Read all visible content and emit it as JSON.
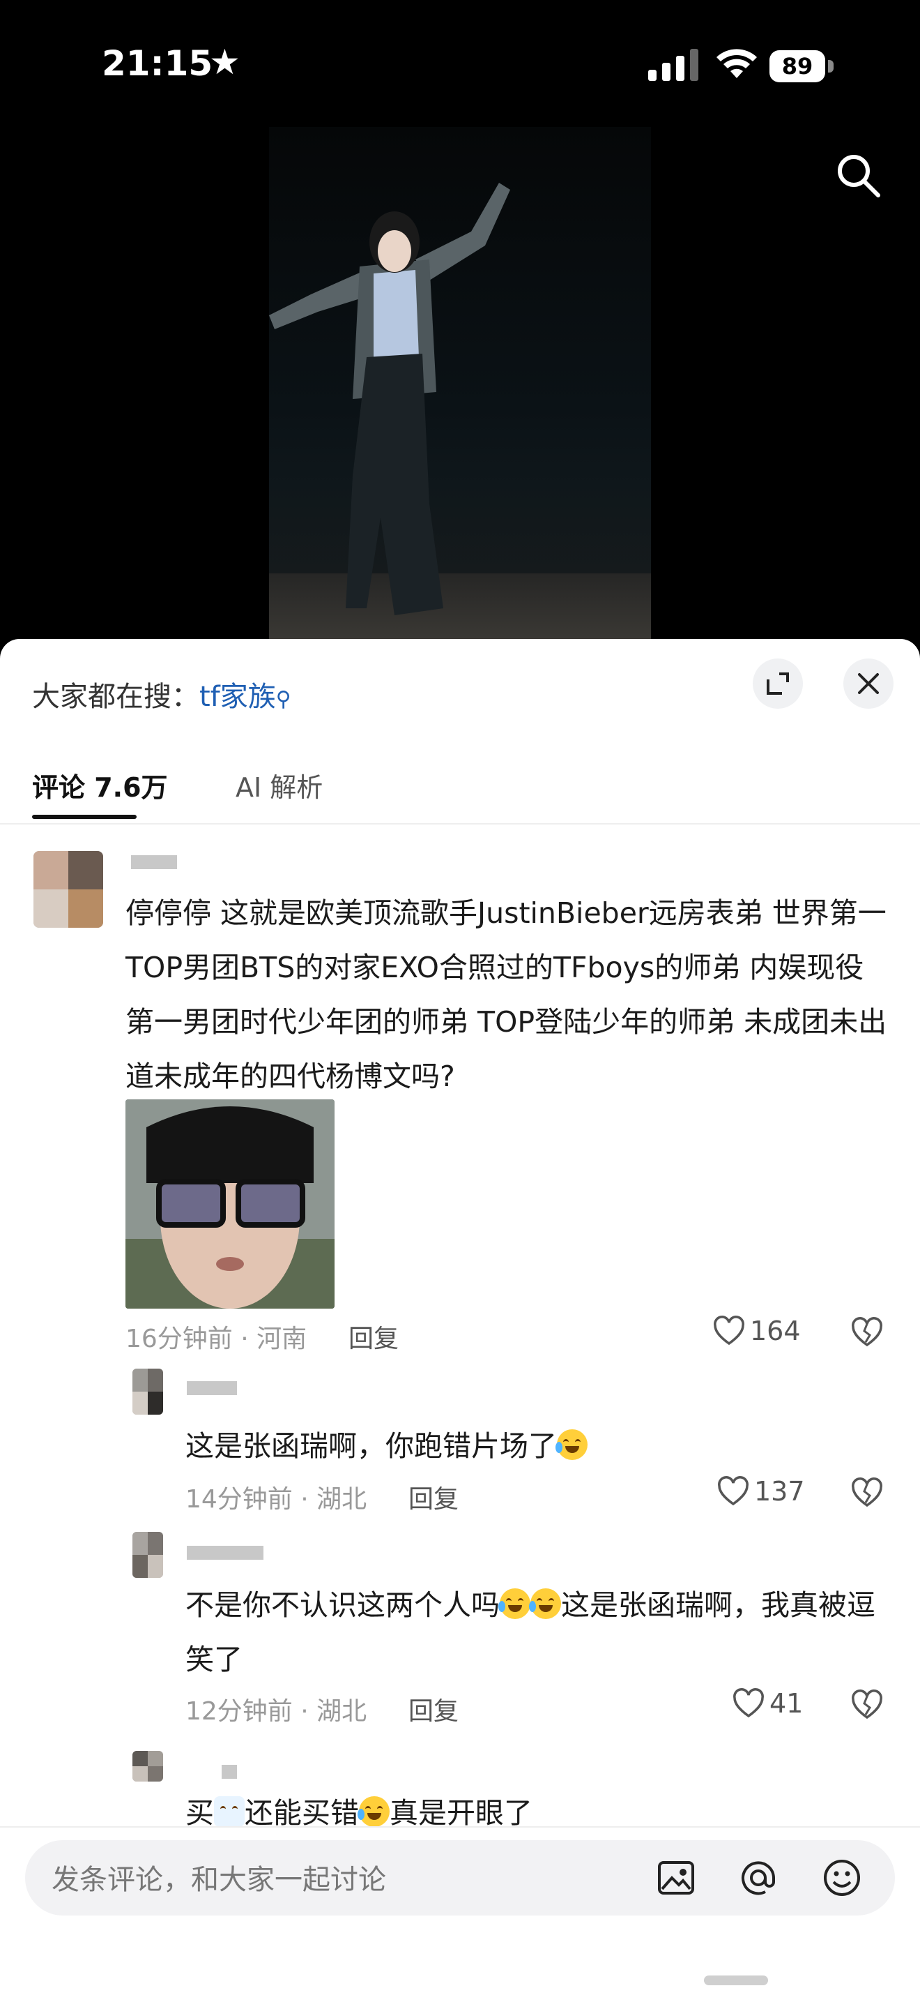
{
  "status_bar": {
    "time": "21:15",
    "battery": "89"
  },
  "search_hint": {
    "prefix": "大家都在搜：",
    "term": "tf家族"
  },
  "tabs": {
    "comments": "评论 7.6万",
    "ai": "AI 解析"
  },
  "comments": [
    {
      "text": "停停停 这就是欧美顶流歌手JustinBieber远房表弟 世界第一TOP男团BTS的对家EXO合照过的TFboys的师弟 内娱现役第一男团时代少年团的师弟 TOP登陆少年的师弟 未成团未出道未成年的四代杨博文吗?",
      "meta": "16分钟前 · 河南",
      "reply": "回复",
      "likes": "164"
    },
    {
      "text": "这是张函瑞啊，你跑错片场了",
      "meta": "14分钟前 · 湖北",
      "reply": "回复",
      "likes": "137"
    },
    {
      "text_a": "不是你不认识这两个人吗",
      "text_b": "这是张函瑞啊，我真被逗笑了",
      "meta": "12分钟前 · 湖北",
      "reply": "回复",
      "likes": "41"
    },
    {
      "text_a": "买",
      "text_b": "还能买错",
      "text_c": "真是开眼了"
    }
  ],
  "input": {
    "placeholder": "发条评论，和大家一起讨论"
  },
  "icons": {
    "search": "search-icon",
    "expand": "expand-icon",
    "close": "close-icon",
    "like": "heart-icon",
    "dislike": "broken-heart-icon",
    "image": "image-icon",
    "mention": "at-icon",
    "emoji": "emoji-icon"
  }
}
